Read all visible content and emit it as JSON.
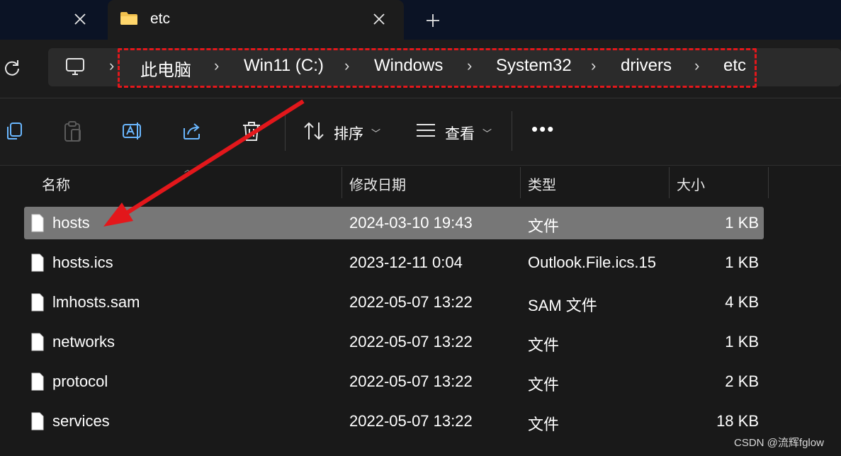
{
  "tab": {
    "title": "etc"
  },
  "breadcrumb": [
    "此电脑",
    "Win11 (C:)",
    "Windows",
    "System32",
    "drivers",
    "etc"
  ],
  "toolbar": {
    "sort_label": "排序",
    "view_label": "查看",
    "more_label": "•••"
  },
  "columns": {
    "name": "名称",
    "modified": "修改日期",
    "type": "类型",
    "size": "大小"
  },
  "files": [
    {
      "name": "hosts",
      "modified": "2024-03-10 19:43",
      "type": "文件",
      "size": "1 KB",
      "selected": true
    },
    {
      "name": "hosts.ics",
      "modified": "2023-12-11 0:04",
      "type": "Outlook.File.ics.15",
      "size": "1 KB"
    },
    {
      "name": "lmhosts.sam",
      "modified": "2022-05-07 13:22",
      "type": "SAM 文件",
      "size": "4 KB"
    },
    {
      "name": "networks",
      "modified": "2022-05-07 13:22",
      "type": "文件",
      "size": "1 KB"
    },
    {
      "name": "protocol",
      "modified": "2022-05-07 13:22",
      "type": "文件",
      "size": "2 KB"
    },
    {
      "name": "services",
      "modified": "2022-05-07 13:22",
      "type": "文件",
      "size": "18 KB"
    }
  ],
  "watermark": "CSDN @流辉fglow",
  "icons": [
    "folder-icon",
    "close-icon",
    "plus-icon",
    "refresh-icon",
    "computer-icon",
    "copy-icon",
    "paste-icon",
    "rename-icon",
    "share-icon",
    "delete-icon",
    "sort-icon",
    "view-icon",
    "file-icon"
  ],
  "colors": {
    "accent_red": "#e3171b",
    "selected_row": "#777777",
    "tabstrip": "#0b1325"
  }
}
